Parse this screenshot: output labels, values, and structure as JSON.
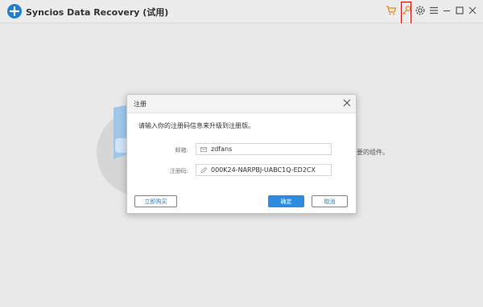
{
  "app": {
    "title": "Syncios Data Recovery (试用)"
  },
  "toolbar": {
    "icons": [
      "cart-icon",
      "key-icon",
      "gear-icon",
      "menu-icon",
      "minimize-icon",
      "maximize-icon",
      "close-icon"
    ]
  },
  "background": {
    "partial_text": "要的组件。"
  },
  "dialog": {
    "title": "注册",
    "prompt": "请输入你的注册码信息来升级到注册版。",
    "email": {
      "label": "邮箱:",
      "value": "zdfans"
    },
    "code": {
      "label": "注册码:",
      "value": "000K24-NARPBJ-UABC1Q-ED2CX"
    },
    "buy_label": "立即购买",
    "ok_label": "确定",
    "cancel_label": "取消"
  },
  "colors": {
    "accent": "#2e8ce0",
    "cart": "#e08a1e",
    "highlight": "#d01010"
  }
}
